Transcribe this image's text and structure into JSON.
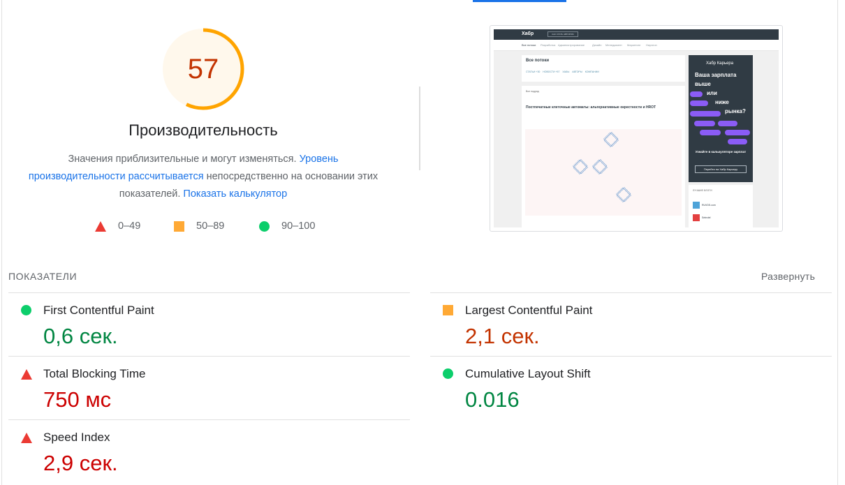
{
  "score": {
    "value": "57",
    "fraction": 0.57,
    "color": "#ffa400",
    "title": "Производительность"
  },
  "description": {
    "text1": "Значения приблизительные и могут изменяться. ",
    "link1": "Уровень производительности рассчитывается",
    "text2": " непосредственно на основании этих показателей. ",
    "link2": "Показать калькулятор"
  },
  "legend": [
    {
      "label": "0–49",
      "icon": "red-triangle-icon",
      "color": "#eb3a33"
    },
    {
      "label": "50–89",
      "icon": "orange-square-icon",
      "color": "#ffa935"
    },
    {
      "label": "90–100",
      "icon": "green-circle-icon",
      "color": "#0cce6b"
    }
  ],
  "thumbnail": {
    "logo": "Хабр",
    "pill": "КАК СТАТЬ АВТОРОМ",
    "nav": [
      "Все потоки",
      "Разработка",
      "Администрирование",
      "Дизайн",
      "Менеджмент",
      "Маркетинг",
      "Научпоп"
    ],
    "heading": "Все потоки",
    "tabs": [
      "СТАТЬИ +30",
      "НОВОСТИ +57",
      "ХАБЫ",
      "АВТОРЫ",
      "КОМПАНИИ"
    ],
    "filter": "Все подряд",
    "article_title": "Постпечатные клеточные автоматы: альтернативные окрестности и HROT",
    "ad_brand": "Хабр Карьера",
    "ad_lines": [
      "Ваша зарплата",
      "выше",
      "или",
      "ниже",
      "рынка?"
    ],
    "ad_cta": "Узнайте в калькуляторе зарплат",
    "ad_button": "Перейти на Хабр Карьеру",
    "blogs_heading": "ЛУЧШИЕ БЛОГИ",
    "blogs": [
      "RUVDS.com",
      "Selectel"
    ]
  },
  "metrics": {
    "heading": "ПОКАЗАТЕЛИ",
    "expand": "Развернуть",
    "items": [
      {
        "label": "First Contentful Paint",
        "value": "0,6 сек.",
        "status": "good"
      },
      {
        "label": "Largest Contentful Paint",
        "value": "2,1 сек.",
        "status": "average"
      },
      {
        "label": "Total Blocking Time",
        "value": "750 мс",
        "status": "poor"
      },
      {
        "label": "Cumulative Layout Shift",
        "value": "0.016",
        "status": "good"
      },
      {
        "label": "Speed Index",
        "value": "2,9 сек.",
        "status": "poor"
      }
    ]
  }
}
